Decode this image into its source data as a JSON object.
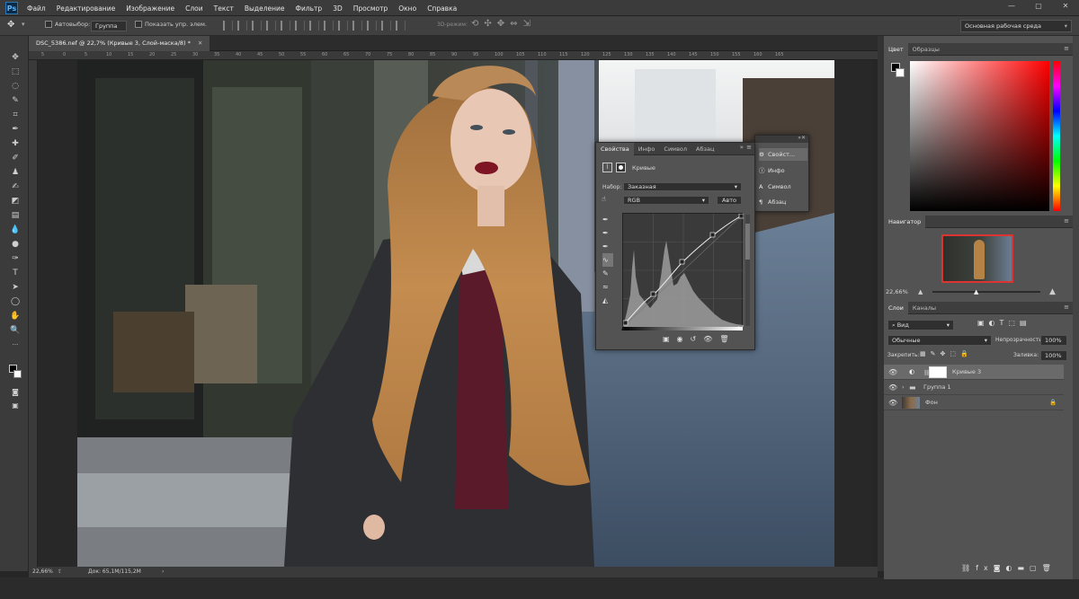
{
  "app": {
    "logo": "Ps"
  },
  "menubar": {
    "items": [
      "Файл",
      "Редактирование",
      "Изображение",
      "Слои",
      "Текст",
      "Выделение",
      "Фильтр",
      "3D",
      "Просмотр",
      "Окно",
      "Справка"
    ]
  },
  "options": {
    "autoselect_label": "Автовыбор:",
    "autoselect_value": "Группа",
    "show_controls_label": "Показать упр. элем.",
    "mode3d_label": "3D-режим:",
    "workspace": "Основная рабочая среда"
  },
  "document": {
    "tab_title": "DSC_5386.nef @ 22,7% (Кривые 3, Слой-маска/8) *",
    "zoom": "22,66%",
    "doc_info": "Док: 65,1M/115,2M",
    "ruler_marks": [
      "5",
      "0",
      "5",
      "10",
      "15",
      "20",
      "25",
      "30",
      "35",
      "40",
      "45",
      "50",
      "55",
      "60",
      "65",
      "70",
      "75",
      "80",
      "85",
      "90",
      "95",
      "100",
      "105",
      "110",
      "115",
      "120",
      "125",
      "130",
      "135",
      "140",
      "145",
      "150",
      "155",
      "160",
      "165"
    ]
  },
  "color_panel": {
    "tabs": [
      "Цвет",
      "Образцы"
    ],
    "active": 0
  },
  "navigator": {
    "tab": "Навигатор",
    "zoom": "22,66%"
  },
  "layers_panel": {
    "tabs": [
      "Слои",
      "Каналы"
    ],
    "filter": "Вид",
    "blend": "Обычные",
    "opacity_label": "Непрозрачность:",
    "opacity_value": "100%",
    "lock_label": "Закрепить:",
    "fill_label": "Заливка:",
    "fill_value": "100%",
    "layers": [
      {
        "name": "Кривые 3",
        "type": "adjustment"
      },
      {
        "name": "Группа 1",
        "type": "group"
      },
      {
        "name": "Фон",
        "type": "background"
      }
    ]
  },
  "properties": {
    "tabs": [
      "Свойства",
      "Инфо",
      "Символ",
      "Абзац"
    ],
    "title": "Кривые",
    "preset_label": "Набор:",
    "preset_value": "Заказная",
    "channel": "RGB",
    "auto_button": "Авто"
  },
  "mini_panel": {
    "items": [
      "Свойст...",
      "Инфо",
      "Символ",
      "Абзац"
    ]
  },
  "colors": {
    "accent_blue": "#4a90d9",
    "red_hue": "#ff0000",
    "panel_bg": "#535353"
  }
}
